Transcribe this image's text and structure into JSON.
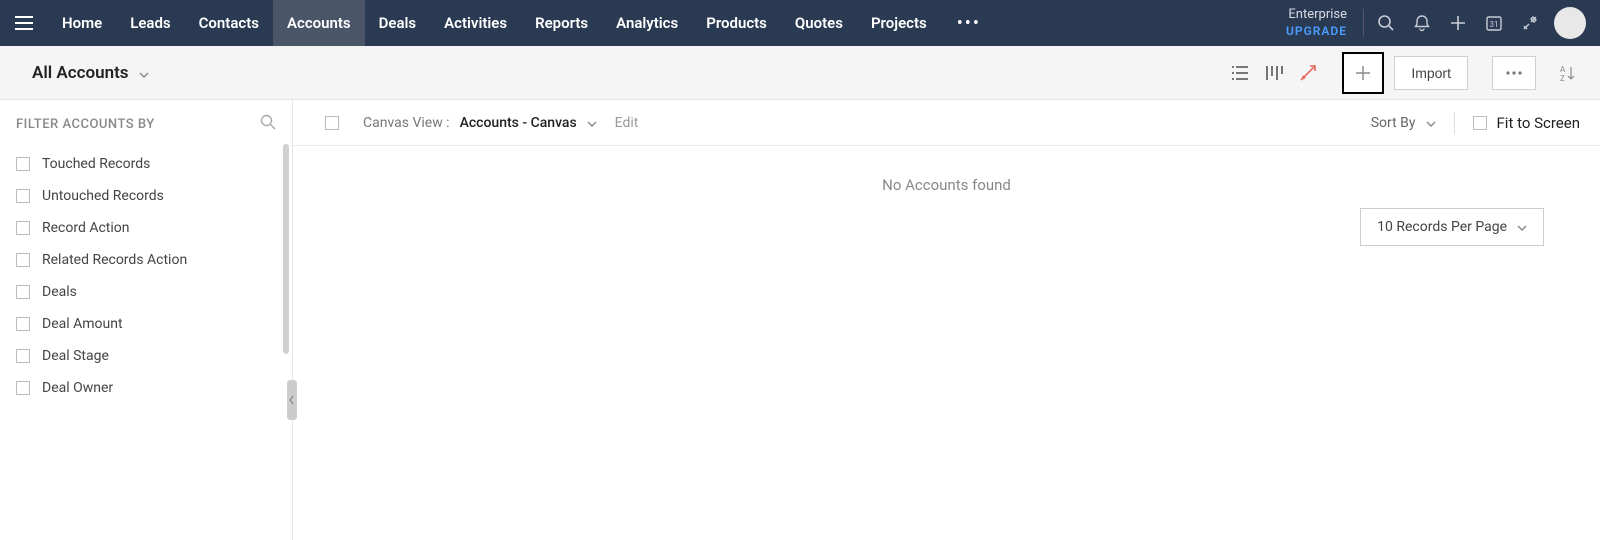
{
  "nav": {
    "items": [
      "Home",
      "Leads",
      "Contacts",
      "Accounts",
      "Deals",
      "Activities",
      "Reports",
      "Analytics",
      "Products",
      "Quotes",
      "Projects"
    ],
    "active_index": 3,
    "plan_name": "Enterprise",
    "upgrade": "UPGRADE"
  },
  "subheader": {
    "view_title": "All Accounts",
    "import_label": "Import"
  },
  "sidebar": {
    "filter_title": "FILTER ACCOUNTS BY",
    "filters": [
      "Touched Records",
      "Untouched Records",
      "Record Action",
      "Related Records Action",
      "Deals",
      "Deal Amount",
      "Deal Stage",
      "Deal Owner"
    ]
  },
  "canvas_bar": {
    "prefix": "Canvas View :",
    "name": "Accounts - Canvas",
    "edit": "Edit",
    "sort_by": "Sort By",
    "fit": "Fit to Screen"
  },
  "main": {
    "empty": "No Accounts found",
    "pager": "10 Records Per Page"
  }
}
